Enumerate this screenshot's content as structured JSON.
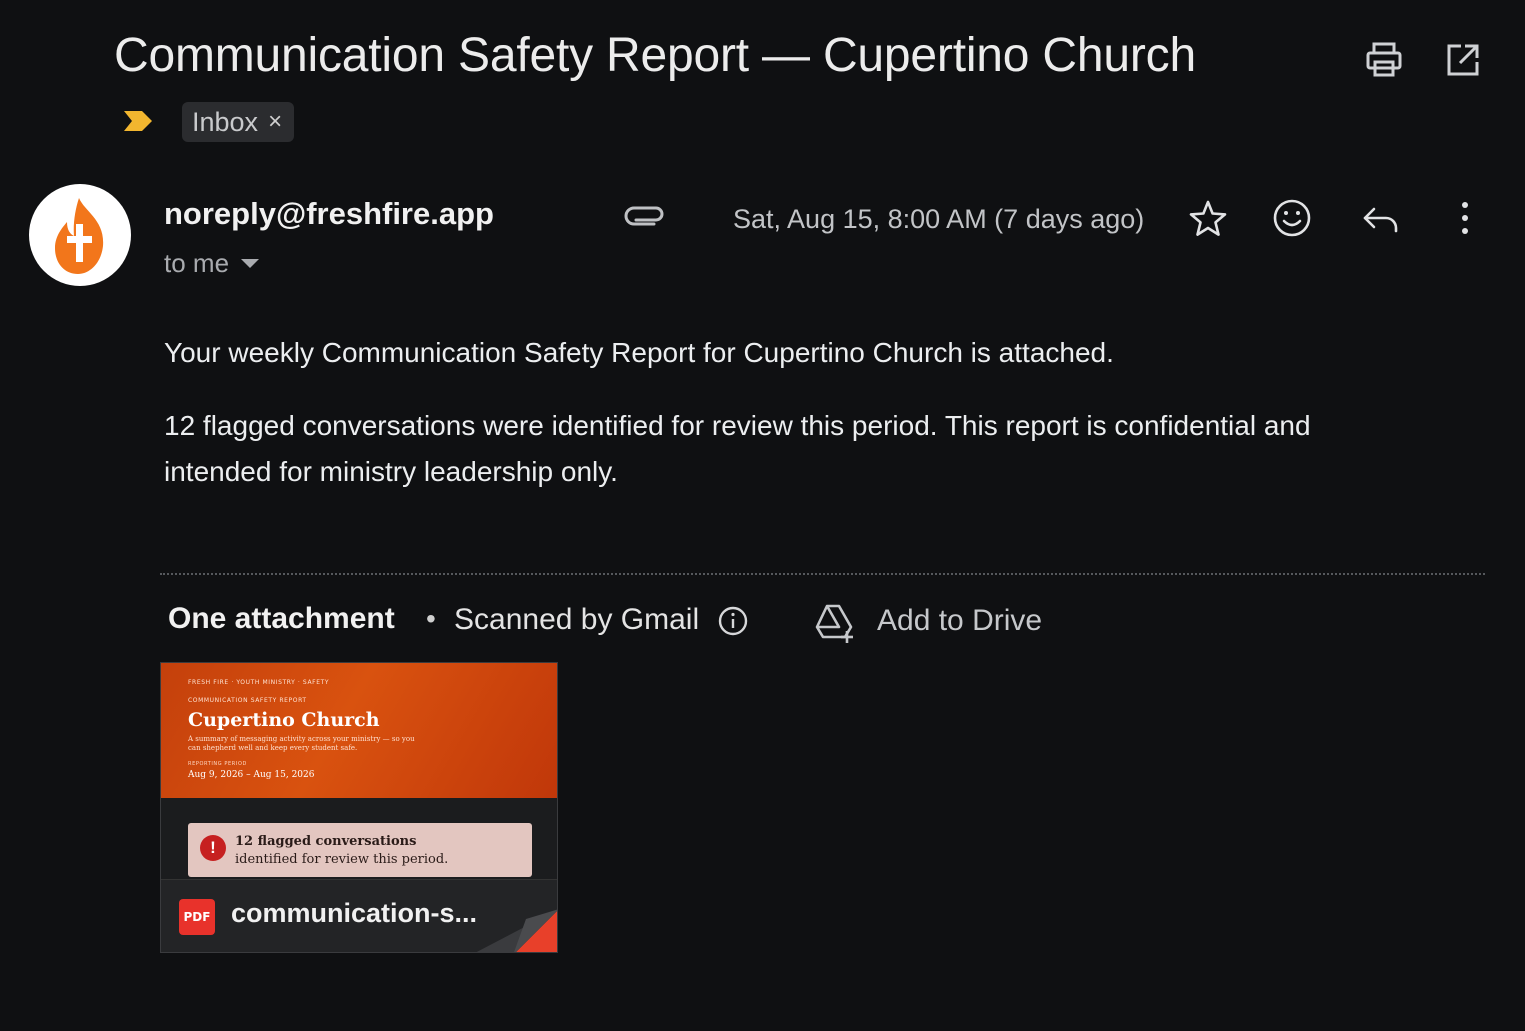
{
  "header": {
    "subject": "Communication Safety Report — Cupertino Church",
    "print_icon": "print-icon",
    "open_new_window_icon": "open-in-new-window-icon",
    "importance_icon": "important-marker-icon",
    "label_chip": "Inbox",
    "label_remove": "×"
  },
  "message": {
    "sender": "noreply@freshfire.app",
    "recipient": "to me",
    "avatar_icon": "flame-cross-logo-icon",
    "attachment_icon": "paperclip-icon",
    "date": "Sat, Aug 15, 8:00 AM (7 days ago)",
    "actions": [
      "star-icon",
      "emoji-reaction-icon",
      "reply-icon",
      "more-options-icon"
    ],
    "body": {
      "paragraph1": "Your weekly Communication Safety Report for Cupertino Church is attached.",
      "paragraph2_line1": "12 flagged conversations were identified for review this period. This report is confidential and",
      "paragraph2_line2": "intended for ministry leadership only."
    }
  },
  "attachments": {
    "title": "One attachment",
    "separator": "•",
    "scanned": "Scanned by Gmail",
    "add_to_drive": "Add to Drive",
    "file": {
      "name": "communication-s...",
      "type_badge": "PDF",
      "preview": {
        "kicker": "FRESH FIRE · YOUTH MINISTRY · SAFETY",
        "report_label": "COMMUNICATION SAFETY REPORT",
        "title": "Cupertino Church",
        "summary": "A summary of messaging activity across your ministry — so you can shepherd well and keep every student safe.",
        "period_label": "REPORTING PERIOD",
        "period": "Aug 9, 2026 – Aug 15, 2026",
        "alert_line1": "12 flagged conversations",
        "alert_line2": "identified for review this period.",
        "alert_icon": "!"
      }
    }
  },
  "colors": {
    "background": "#0f1012",
    "preview_orange": "#d9520f",
    "pdf_red": "#e8322b",
    "important_yellow": "#f2b62f"
  }
}
